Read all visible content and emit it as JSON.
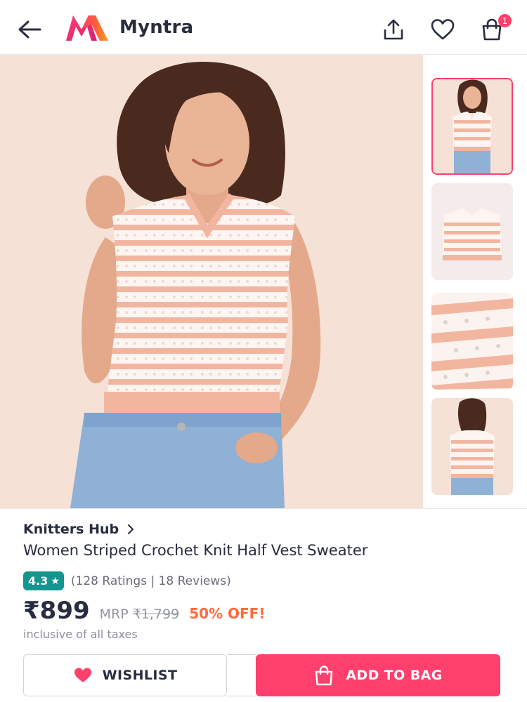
{
  "header": {
    "brand": "Myntra",
    "back_icon": "arrow-left-icon",
    "share_icon": "share-upload-icon",
    "wishlist_icon": "heart-outline-icon",
    "bag_icon": "shopping-bag-icon",
    "bag_count": "1"
  },
  "gallery": {
    "thumbnail_count": 4,
    "selected_thumbnail": 1
  },
  "product": {
    "seller": "Knitters Hub",
    "title": "Women Striped Crochet Knit Half Vest Sweater",
    "rating": "4.3",
    "rating_star": "★",
    "ratings_summary": "(128 Ratings | 18 Reviews)",
    "price": "₹899",
    "mrp_label": "MRP",
    "mrp": "₹1,799",
    "discount": "50% OFF!",
    "tax_note": "inclusive of all taxes"
  },
  "actions": {
    "wishlist_label": "WISHLIST",
    "add_to_bag_label": "ADD TO BAG"
  },
  "colors": {
    "accent": "#ff3f6c",
    "rating_green": "#14958f",
    "discount_orange": "#ff6a3d",
    "sweater_pink": "#f2b6a0",
    "backdrop": "#f6e1d6"
  }
}
